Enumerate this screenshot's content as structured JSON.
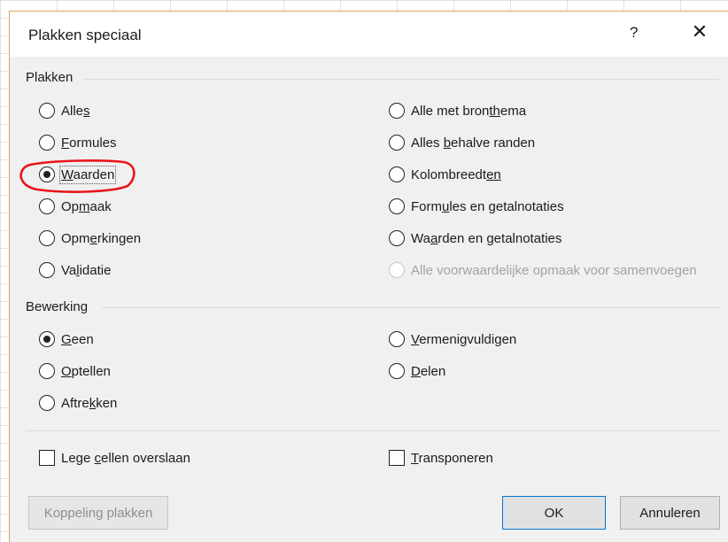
{
  "dialog": {
    "title": "Plakken speciaal",
    "help_label": "?",
    "close_label": "✕"
  },
  "paste_group": {
    "label": "Plakken",
    "options_left": [
      {
        "pre": "Alle",
        "u": "s",
        "post": "",
        "checked": false
      },
      {
        "pre": "",
        "u": "F",
        "post": "ormules",
        "checked": false
      },
      {
        "pre": "",
        "u": "W",
        "post": "aarden",
        "checked": true
      },
      {
        "pre": "Op",
        "u": "m",
        "post": "aak",
        "checked": false
      },
      {
        "pre": "Opm",
        "u": "e",
        "post": "rkingen",
        "checked": false
      },
      {
        "pre": "Va",
        "u": "l",
        "post": "idatie",
        "checked": false
      }
    ],
    "options_right": [
      {
        "pre": "Alle met bron",
        "u": "th",
        "post": "ema",
        "checked": false
      },
      {
        "pre": "Alles ",
        "u": "b",
        "post": "ehalve randen",
        "checked": false
      },
      {
        "pre": "Kolombreedt",
        "u": "en",
        "post": "",
        "checked": false
      },
      {
        "pre": "Form",
        "u": "u",
        "post": "les en getalnotaties",
        "checked": false
      },
      {
        "pre": "Wa",
        "u": "a",
        "post": "rden en getalnotaties",
        "checked": false
      },
      {
        "pre": "Alle voorwaardelijke opmaak voor samenvoegen",
        "u": "",
        "post": "",
        "checked": false,
        "disabled": true
      }
    ]
  },
  "operation_group": {
    "label": "Bewerking",
    "options_left": [
      {
        "pre": "",
        "u": "G",
        "post": "een",
        "checked": true
      },
      {
        "pre": "",
        "u": "O",
        "post": "ptellen",
        "checked": false
      },
      {
        "pre": "Aftre",
        "u": "k",
        "post": "ken",
        "checked": false
      }
    ],
    "options_right": [
      {
        "pre": "",
        "u": "V",
        "post": "ermenigvuldigen",
        "checked": false
      },
      {
        "pre": "",
        "u": "D",
        "post": "elen",
        "checked": false
      }
    ]
  },
  "checkboxes": {
    "skip_blanks": {
      "pre": "Lege ",
      "u": "c",
      "post": "ellen overslaan",
      "checked": false
    },
    "transpose": {
      "pre": "",
      "u": "T",
      "post": "ransponeren",
      "checked": false
    }
  },
  "buttons": {
    "paste_link": "Koppeling plakken",
    "ok": "OK",
    "cancel": "Annuleren"
  },
  "colors": {
    "annotation": "#e8161a",
    "default_button_border": "#0078d7"
  }
}
